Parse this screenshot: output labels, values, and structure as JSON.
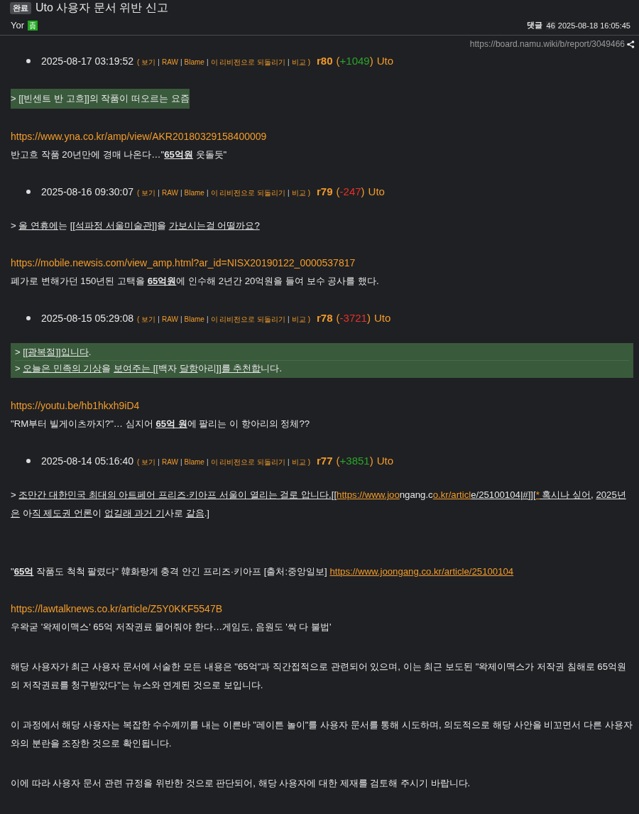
{
  "header": {
    "status": "완료",
    "title": "Uto 사용자 문서 위반 신고",
    "author": "Yor",
    "comments_label": "댓글",
    "comments_count": "46",
    "timestamp": "2025-08-18 16:05:45",
    "url": "https://board.namu.wiki/b/report/3049466"
  },
  "blocks": [
    {
      "kind": "revision",
      "date": "2025-08-17 03:19:52",
      "open": "(",
      "sep": "|",
      "close": ")",
      "actions": [
        "보기",
        "RAW",
        "Blame",
        "이 리비전으로 되돌리기",
        "비교"
      ],
      "rev": "r80",
      "change": "+1049",
      "positive": true,
      "user": "Uto"
    },
    {
      "kind": "quote",
      "wide": false,
      "lines": [
        [
          {
            "text": "> [[빈센트 반 고흐]]의 작품이 떠오르는 요즘",
            "kind": "plain"
          }
        ]
      ]
    },
    {
      "kind": "link",
      "text": "https://www.yna.co.kr/amp/view/AKR20180329158400009"
    },
    {
      "kind": "para",
      "segments": [
        {
          "text": "반고흐 작품 20년만에 경매 나온다…\"",
          "kind": "plain"
        },
        {
          "text": "65억원",
          "kind": "bold"
        },
        {
          "text": " 웃돌듯\"",
          "kind": "plain"
        }
      ]
    },
    {
      "kind": "revision",
      "date": "2025-08-16 09:30:07",
      "open": "(",
      "sep": "|",
      "close": ")",
      "actions": [
        "보기",
        "RAW",
        "Blame",
        "이 리비전으로 되돌리기",
        "비교"
      ],
      "rev": "r79",
      "change": "-247",
      "positive": false,
      "user": "Uto"
    },
    {
      "kind": "para",
      "segments": [
        {
          "text": "> ",
          "kind": "plain"
        },
        {
          "text": "올 연휴에",
          "kind": "underline"
        },
        {
          "text": "는 [[",
          "kind": "plain"
        },
        {
          "text": "석파정 서울미술관",
          "kind": "underline"
        },
        {
          "text": "]]을 ",
          "kind": "plain"
        },
        {
          "text": "가보시는걸 어떨까요?",
          "kind": "underline"
        }
      ]
    },
    {
      "kind": "link",
      "text": "https://mobile.newsis.com/view_amp.html?ar_id=NISX20190122_0000537817"
    },
    {
      "kind": "para",
      "segments": [
        {
          "text": "폐가로 변해가던 150년된 고택을 ",
          "kind": "plain"
        },
        {
          "text": "65억원",
          "kind": "bold"
        },
        {
          "text": "에 인수해 2년간 20억원을 들여 보수 공사를 했다.",
          "kind": "plain"
        }
      ]
    },
    {
      "kind": "revision",
      "date": "2025-08-15 05:29:08",
      "open": "(",
      "sep": "|",
      "close": ")",
      "actions": [
        "보기",
        "RAW",
        "Blame",
        "이 리비전으로 되돌리기",
        "비교 "
      ],
      "rev": "r78",
      "change": "-3721",
      "positive": false,
      "user": "Uto"
    },
    {
      "kind": "quote",
      "wide": true,
      "lines": [
        [
          {
            "text": "> [[",
            "kind": "plain"
          },
          {
            "text": "광복절",
            "kind": "underline"
          },
          {
            "text": "]]",
            "kind": "plain"
          },
          {
            "text": "입니다",
            "kind": "underline"
          },
          {
            "text": ".",
            "kind": "plain"
          }
        ],
        [
          {
            "text": "> ",
            "kind": "plain"
          },
          {
            "text": "오늘은 민족의 기상",
            "kind": "underline"
          },
          {
            "text": "을 ",
            "kind": "plain"
          },
          {
            "text": "보여주는 ",
            "kind": "underline"
          },
          {
            "text": "[[백자 ",
            "kind": "plain"
          },
          {
            "text": "달항",
            "kind": "underline"
          },
          {
            "text": "아리",
            "kind": "plain"
          },
          {
            "text": "]]를 추천합",
            "kind": "underline"
          },
          {
            "text": "니다.",
            "kind": "plain"
          }
        ]
      ]
    },
    {
      "kind": "link",
      "text": "https://youtu.be/hb1hkxh9iD4"
    },
    {
      "kind": "para",
      "segments": [
        {
          "text": "\"RM부터 빌게이츠까지?\"… 심지어 ",
          "kind": "plain"
        },
        {
          "text": "65억 원",
          "kind": "bold"
        },
        {
          "text": "에 팔리는 이 항아리의 정체??",
          "kind": "plain"
        }
      ]
    },
    {
      "kind": "revision",
      "date": "2025-08-14 05:16:40",
      "open": "(",
      "sep": "|",
      "close": ")",
      "actions": [
        "보기",
        "RAW",
        "Blame",
        "이 리비전으로 되돌리기",
        "비교"
      ],
      "rev": "r77",
      "change": "+3851",
      "positive": true,
      "user": "Uto"
    },
    {
      "kind": "para",
      "segments": [
        {
          "text": "> ",
          "kind": "plain"
        },
        {
          "text": "조만간 대한민국 최대의 아트페어 프리즈·키아프 서울이 열리는 걸로 압니다.",
          "kind": "underline"
        },
        {
          "text": "[[",
          "kind": "plain"
        },
        {
          "text": "https://www.joo",
          "kind": "link"
        },
        {
          "text": "ngang.c",
          "kind": "plain"
        },
        {
          "text": "o.kr/articl",
          "kind": "link"
        },
        {
          "text": "e/25100104|#]]",
          "kind": "underline"
        },
        {
          "text": "[",
          "kind": "plain"
        },
        {
          "text": "*",
          "kind": "link"
        },
        {
          "text": " 혹시나 싶어",
          "kind": "underline"
        },
        {
          "text": ", ",
          "kind": "plain"
        },
        {
          "text": "2025년은",
          "kind": "underline"
        },
        {
          "text": " 아",
          "kind": "plain"
        },
        {
          "text": "직 제도권 언론",
          "kind": "underline"
        },
        {
          "text": "이 ",
          "kind": "plain"
        },
        {
          "text": "없길래 과거 기",
          "kind": "underline"
        },
        {
          "text": "사로 ",
          "kind": "plain"
        },
        {
          "text": "같음",
          "kind": "underline"
        },
        {
          "text": ".]",
          "kind": "plain"
        }
      ]
    },
    {
      "kind": "citation",
      "segments": [
        {
          "text": "\"",
          "kind": "plain"
        },
        {
          "text": "65억",
          "kind": "bold"
        },
        {
          "text": " 작품도 척척 팔렸다\" 韓화랑계 충격 안긴 프리즈·키아프 [출처:중앙일보] ",
          "kind": "plain"
        },
        {
          "text": "https://www.joongang.co.kr/article/25100104",
          "kind": "link"
        }
      ]
    },
    {
      "kind": "link",
      "text": "https://lawtalknews.co.kr/article/Z5Y0KKF5547B"
    },
    {
      "kind": "para",
      "segments": [
        {
          "text": "우왁굳 '왁제이맥스' 65억 저작권료 물어줘야 한다…게임도, 음원도 '싹 다 불법'",
          "kind": "plain"
        }
      ]
    },
    {
      "kind": "para",
      "segments": [
        {
          "text": "해당 사용자가 최근 사용자 문서에 서술한 모든 내용은 \"65억\"과 직간접적으로 관련되어 있으며, 이는 최근 보도된 \"왁제이맥스가 저작권 침해로 65억원의 저작권료를 청구받았다\"는 뉴스와 연계된 것으로 보입니다.",
          "kind": "plain"
        }
      ]
    },
    {
      "kind": "para",
      "segments": [
        {
          "text": "이 과정에서 해당 사용자는 복잡한 수수께끼를 내는 이른바 \"레이튼 놀이\"를 사용자 문서를 통해 시도하며, 의도적으로 해당 사안을 비꼬면서 다른 사용자와의 분란을 조장한 것으로 확인됩니다.",
          "kind": "plain"
        }
      ]
    },
    {
      "kind": "para",
      "segments": [
        {
          "text": "이에 따라 사용자 문서 관련 규정을 위반한 것으로 판단되어, 해당 사용자에 대한 제재를 검토해 주시기 바랍니다.",
          "kind": "plain"
        }
      ]
    }
  ]
}
